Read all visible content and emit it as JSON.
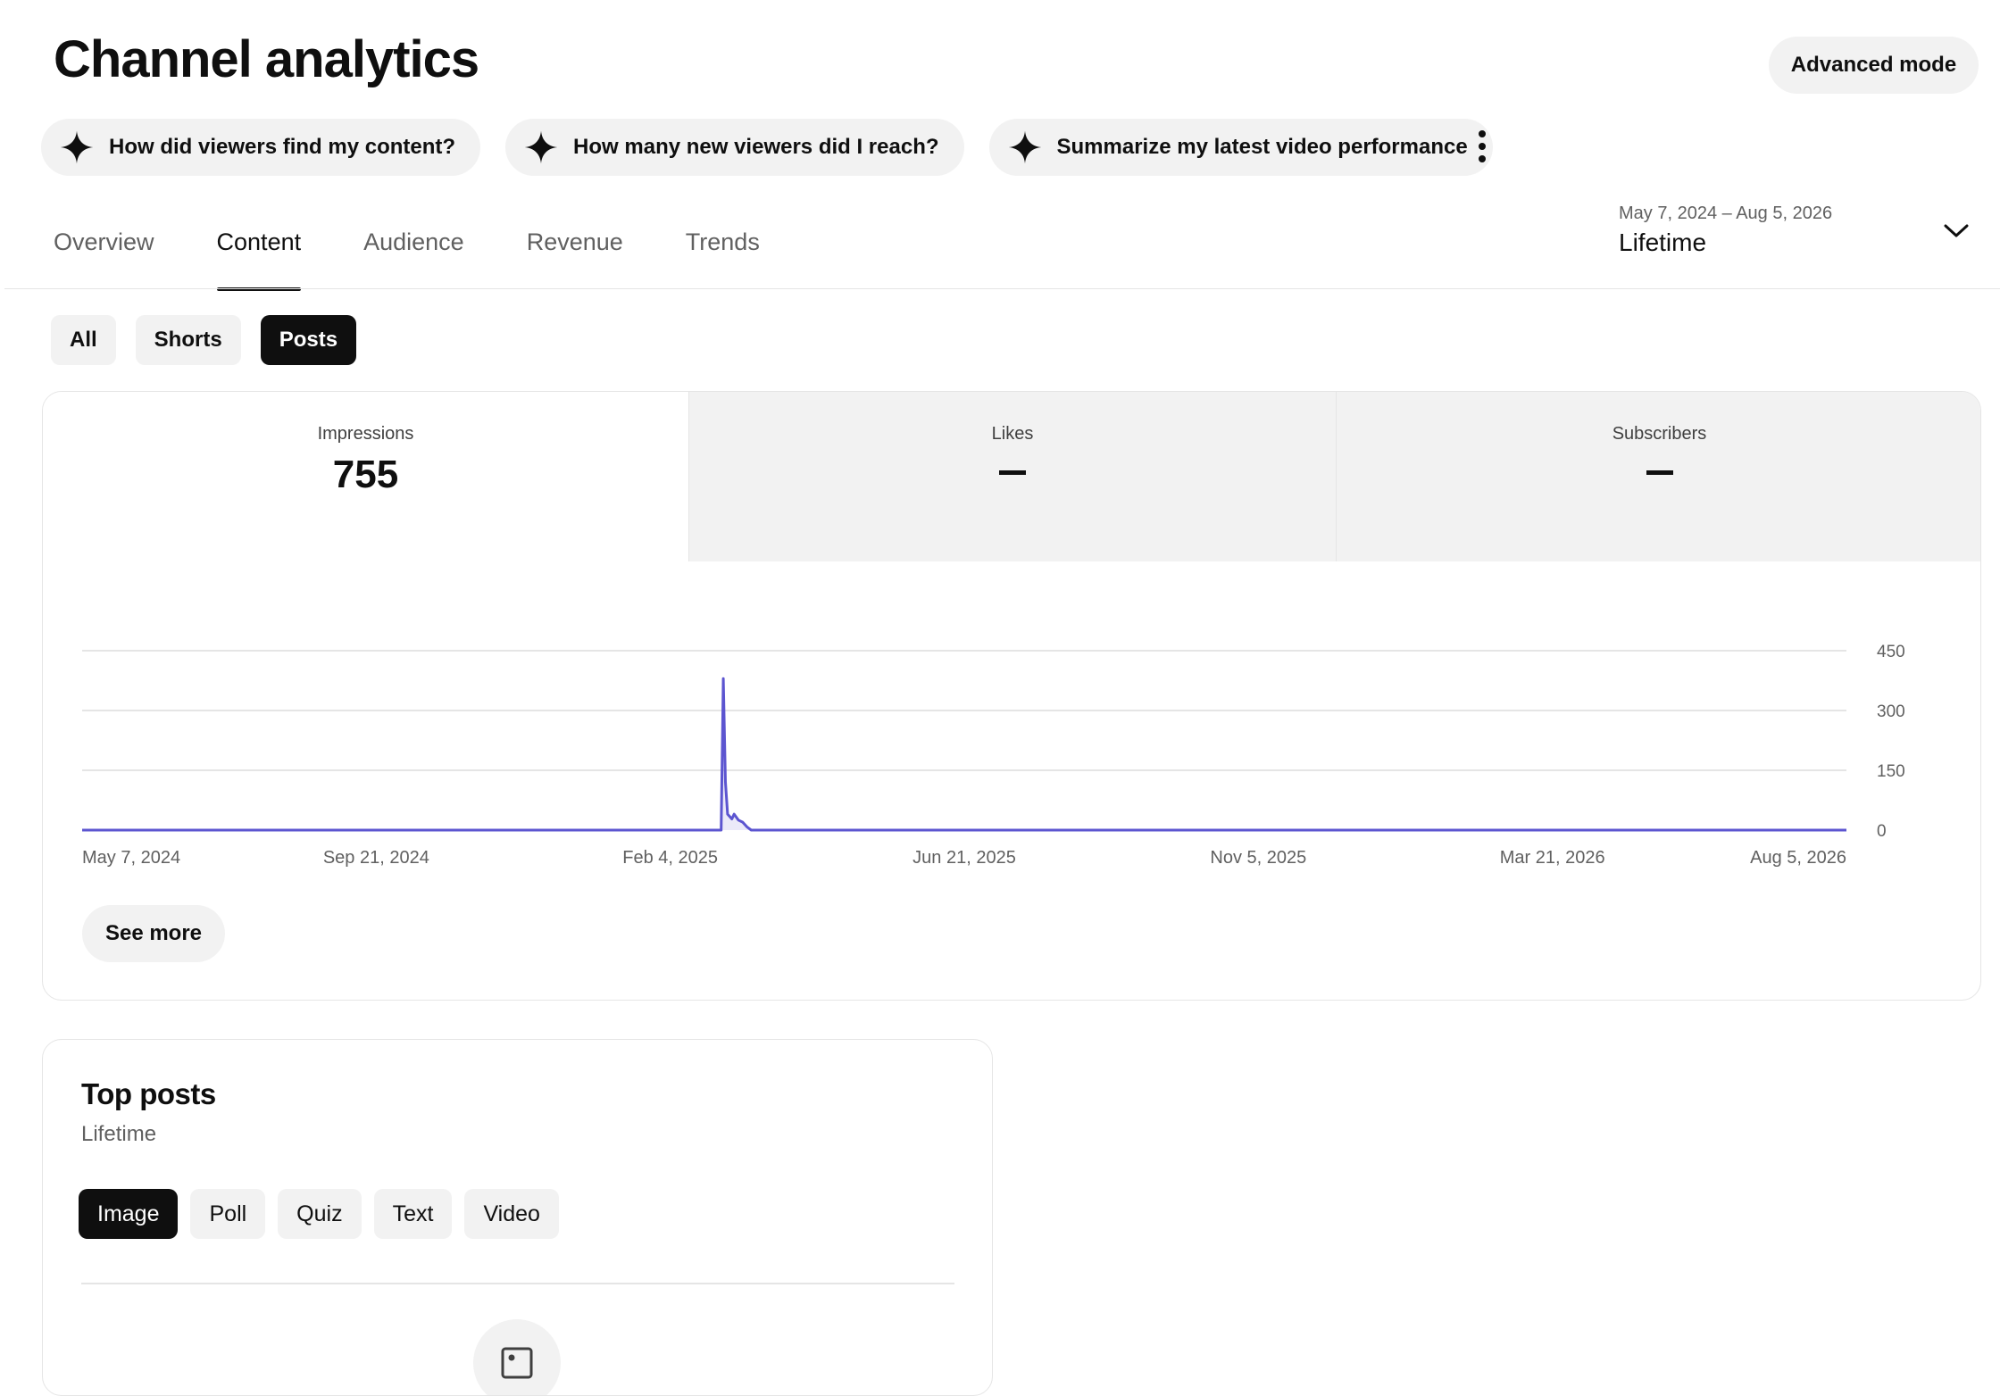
{
  "header": {
    "title": "Channel analytics",
    "advanced_mode_label": "Advanced mode"
  },
  "ai_prompts": [
    {
      "label": "How did viewers find my content?",
      "icon": "sparkle-icon"
    },
    {
      "label": "How many new viewers did I reach?",
      "icon": "sparkle-icon"
    },
    {
      "label": "Summarize my latest video performance",
      "icon": "sparkle-icon"
    }
  ],
  "tabs": [
    {
      "label": "Overview",
      "active": false
    },
    {
      "label": "Content",
      "active": true
    },
    {
      "label": "Audience",
      "active": false
    },
    {
      "label": "Revenue",
      "active": false
    },
    {
      "label": "Trends",
      "active": false
    }
  ],
  "date_range": {
    "range": "May 7, 2024 – Aug 5, 2026",
    "label": "Lifetime"
  },
  "content_filters": [
    {
      "label": "All",
      "selected": false
    },
    {
      "label": "Shorts",
      "selected": false
    },
    {
      "label": "Posts",
      "selected": true
    }
  ],
  "metrics": [
    {
      "label": "Impressions",
      "value": "755",
      "selected": true
    },
    {
      "label": "Likes",
      "value": "–",
      "selected": false
    },
    {
      "label": "Subscribers",
      "value": "–",
      "selected": false
    }
  ],
  "chart_data": {
    "type": "line",
    "title": "",
    "xlabel": "",
    "ylabel": "",
    "x_tick_labels": [
      "May 7, 2024",
      "Sep 21, 2024",
      "Feb 4, 2025",
      "Jun 21, 2025",
      "Nov 5, 2025",
      "Mar 21, 2026",
      "Aug 5, 2026"
    ],
    "y_ticks": [
      0,
      150,
      300,
      450
    ],
    "ylim": [
      0,
      450
    ],
    "xlim": [
      "2024-05-07",
      "2026-08-05"
    ],
    "grid": true,
    "series": [
      {
        "color": "#5c55d0",
        "points": [
          [
            "2024-05-07",
            0
          ],
          [
            "2025-02-28",
            0
          ],
          [
            "2025-03-01",
            380
          ],
          [
            "2025-03-02",
            120
          ],
          [
            "2025-03-03",
            40
          ],
          [
            "2025-03-05",
            28
          ],
          [
            "2025-03-06",
            40
          ],
          [
            "2025-03-08",
            25
          ],
          [
            "2025-03-10",
            20
          ],
          [
            "2025-03-12",
            8
          ],
          [
            "2025-03-14",
            0
          ],
          [
            "2026-08-05",
            0
          ]
        ]
      }
    ]
  },
  "see_more_label": "See more",
  "top_posts": {
    "title": "Top posts",
    "subtitle": "Lifetime",
    "types": [
      {
        "label": "Image",
        "selected": true
      },
      {
        "label": "Poll",
        "selected": false
      },
      {
        "label": "Quiz",
        "selected": false
      },
      {
        "label": "Text",
        "selected": false
      },
      {
        "label": "Video",
        "selected": false
      }
    ]
  }
}
